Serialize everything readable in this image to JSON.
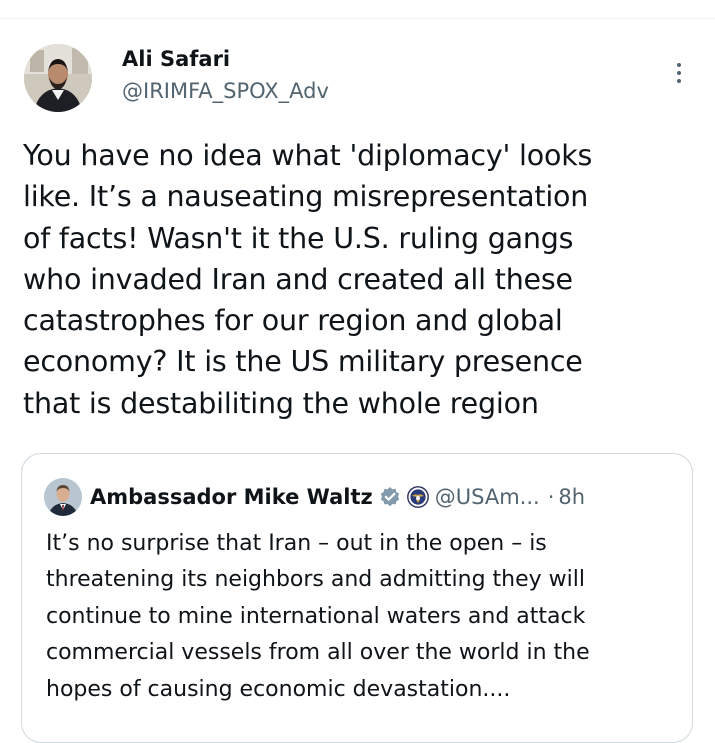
{
  "tweet": {
    "author": {
      "display_name": "Ali Safari",
      "handle": "@IRIMFA_SPOX_Adv"
    },
    "more_icon": "more-vertical-icon",
    "text": "You have no idea what 'diplomacy' looks\nlike. It’s a nauseating misrepresentation\nof facts! Wasn't it the U.S. ruling gangs\nwho invaded Iran and created all these\ncatastrophes for our region and global\neconomy? It is the US military presence\nthat is destabiliting the whole region"
  },
  "quoted_tweet": {
    "author": {
      "display_name": "Ambassador Mike Waltz",
      "handle": "@USAm...",
      "badges": [
        "verified-badge-icon",
        "government-seal-icon"
      ]
    },
    "separator": "·",
    "time": "8h",
    "text": "It’s no surprise that Iran – out in the open –  is\nthreatening its neighbors and admitting they will\ncontinue to mine international waters and attack\ncommercial vessels from all over the world in the\nhopes of causing economic devastation...."
  },
  "colors": {
    "text_primary": "#0f1419",
    "text_secondary": "#536471",
    "border": "#cfd9de",
    "verified_badge": "#829aab"
  }
}
